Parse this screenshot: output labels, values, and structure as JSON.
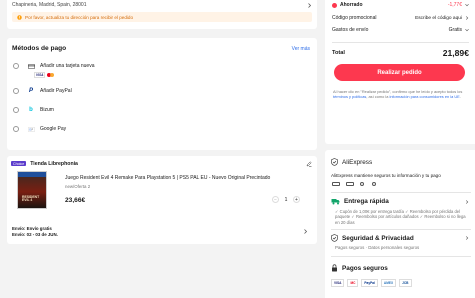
{
  "address": {
    "text": "Chapineria, Madrid, Spain, 28001",
    "warning": "Por favor, actualiza tu dirección para recibir el pedido"
  },
  "payment": {
    "title": "Métodos de pago",
    "view_more": "Ver más",
    "options": [
      {
        "label": "Añadir una tarjeta nueva"
      },
      {
        "label": "Añadir PayPal"
      },
      {
        "label": "Bizum"
      },
      {
        "label": "Google Pay"
      }
    ],
    "card_logos": {
      "visa": "VISA"
    }
  },
  "store": {
    "badge": "Choice",
    "name": "Tienda Librephonia",
    "product": {
      "title": "Juego Resident Evil 4 Remake Para Playstation 5 | PS5 PAL EU - Nuevo Original Precintado",
      "variant": "new/Oferta 2",
      "price": "23,66€",
      "quantity": "1"
    },
    "shipping_line1": "Envío: Envío gratis",
    "shipping_line2": "Envío: 02 - 03 de JUN."
  },
  "summary": {
    "saved_label": "Ahorrado",
    "saved_value": "-1,77€",
    "promo_label": "Código promocional",
    "promo_value": "Escribe el código aqui",
    "shipping_label": "Gastos de envío",
    "shipping_value": "Gratis",
    "total_label": "Total",
    "total_value": "21,89€",
    "button": "Realizar pedido",
    "legal_1": "Al hacer clic en \"Realizar pedido\", confirmo que he leído y acepto todos los ",
    "legal_link1": "términos y políticas",
    "legal_2": ", así como la ",
    "legal_link2": "información para consumidores en la UE",
    "legal_3": "."
  },
  "trust": {
    "brand": "AliExpress",
    "tagline": "AliExpress mantiene seguros tu información y tu pago",
    "delivery_title": "Entrega rápida",
    "delivery_text": "✓ Cupón de 1,00€ por entrega tardía ✓ Reembolso por pérdida del paquete ✓ Reembolso por artículos dañados ✓ Reembolso si no llega en 20 días",
    "security_title": "Seguridad & Privacidad",
    "security_text": "Pagos seguros · Datos personales seguros",
    "payments_title": "Pagos seguros",
    "payment_badges": [
      "VISA",
      "MC",
      "PayPal",
      "AMEX",
      "JCB"
    ]
  },
  "colors": {
    "accent_red": "#fd384f",
    "link_blue": "#2e6de8",
    "warning_bg": "#fff3e6",
    "warning_text": "#d46b08",
    "choice_purple": "#5b3ccc",
    "truck_green": "#12a56a"
  }
}
